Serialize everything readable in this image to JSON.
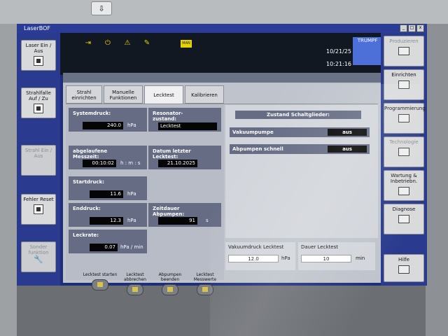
{
  "window": {
    "title": "LaserBOF",
    "controls": [
      "_",
      "□",
      "x"
    ]
  },
  "top_button_icon": "download-arrow-icon",
  "statusbar": {
    "icons": [
      "exit-icon",
      "power-icon",
      "warning-icon",
      "wrench-icon"
    ],
    "mode_badge": "MAN",
    "date": "10/21/25",
    "time": "10:21:16",
    "logo": "TRUMPF"
  },
  "left_buttons": [
    {
      "label": "Laser Ein / Aus",
      "disabled": false
    },
    {
      "label": "Strahlfalle Auf / Zu",
      "disabled": false
    },
    {
      "label": "Strahl Ein / Aus",
      "disabled": true
    },
    {
      "label": "Fehler Reset",
      "disabled": false
    },
    {
      "label": "Sonder funktion",
      "disabled": true
    }
  ],
  "right_buttons": [
    {
      "label": "Produzieren",
      "grey": true
    },
    {
      "label": "Einrichten",
      "grey": false
    },
    {
      "label": "Programmierung",
      "grey": false
    },
    {
      "label": "Technologie",
      "grey": true
    },
    {
      "label": "Wartung & Inbetriebn.",
      "grey": false
    },
    {
      "label": "Diagnose",
      "grey": false
    },
    {
      "label": "Hilfe",
      "grey": false
    }
  ],
  "tabs": [
    {
      "label": "Strahl einrichten",
      "active": false
    },
    {
      "label": "Manuelle Funktionen",
      "active": false
    },
    {
      "label": "Lecktest",
      "active": true
    },
    {
      "label": "Kalibrieren",
      "active": false
    }
  ],
  "lecktest": {
    "systemdruck": {
      "label": "Systemdruck:",
      "value": "240.0",
      "unit": "hPa"
    },
    "resonator": {
      "label": "Resonator-zustand:",
      "value": "Lecktest"
    },
    "messzeit": {
      "label": "abgelaufene Messzeit:",
      "value": "00:10:02",
      "unit": "h : m : s"
    },
    "datum": {
      "label": "Datum letzter Lecktest:",
      "value": "21.10.2025"
    },
    "startdruck": {
      "label": "Startdruck:",
      "value": "11.6",
      "unit": "hPa"
    },
    "enddruck": {
      "label": "Enddruck:",
      "value": "12.3",
      "unit": "hPa"
    },
    "zeitdauer": {
      "label": "Zeitdauer Abpumpen:",
      "value": "91",
      "unit": "s"
    },
    "leckrate": {
      "label": "Leckrate:",
      "value": "0.07",
      "unit": "hPa / min"
    }
  },
  "schaltglieder": {
    "title": "Zustand Schaltglieder:",
    "rows": [
      {
        "label": "Vakuumpumpe",
        "value": "aus"
      },
      {
        "label": "Abpumpen schnell",
        "value": "aus"
      }
    ]
  },
  "lower": {
    "vakuumdruck": {
      "label": "Vakuumdruck Lecktest",
      "value": "12.0",
      "unit": "hPa"
    },
    "dauer": {
      "label": "Dauer Lecktest",
      "value": "10",
      "unit": "min"
    }
  },
  "actions": [
    {
      "label": "Lecktest starten"
    },
    {
      "label": "Lecktest abbrechen"
    },
    {
      "label": "Abpumpen beenden"
    },
    {
      "label": "Lecktest Messwerte"
    }
  ]
}
